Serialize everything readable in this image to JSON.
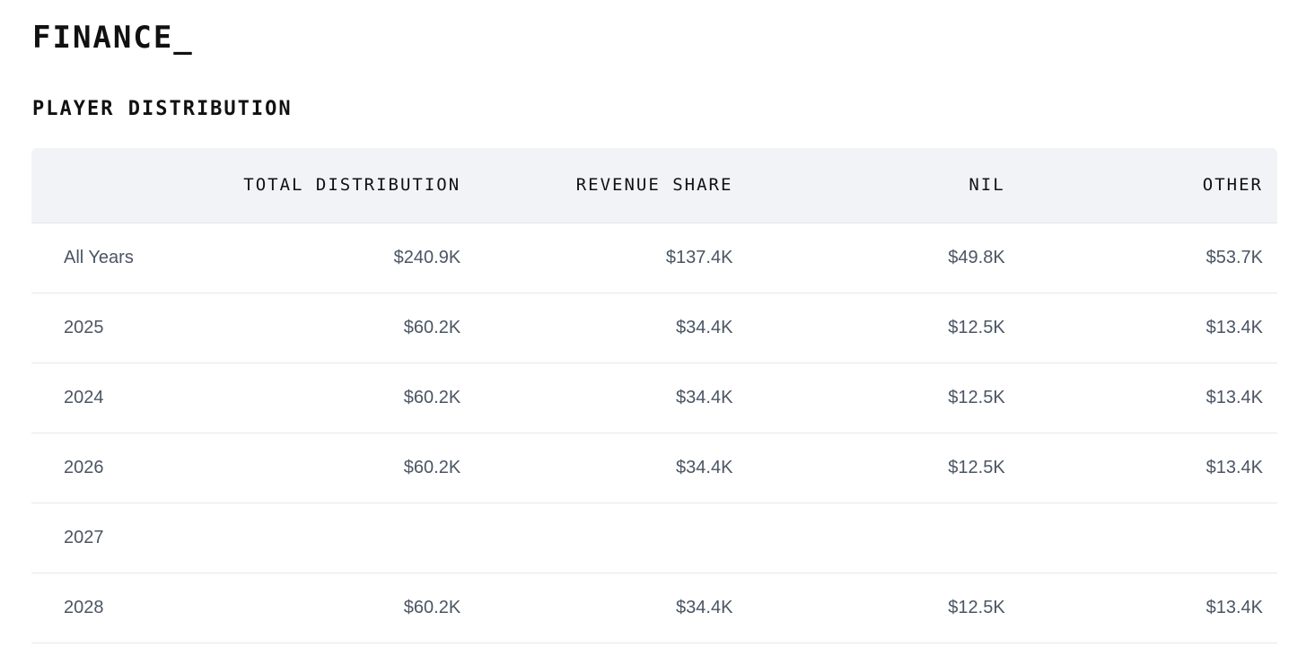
{
  "app": {
    "title": "FINANCE_"
  },
  "section": {
    "title": "PLAYER DISTRIBUTION"
  },
  "table": {
    "headers": [
      "",
      "TOTAL DISTRIBUTION",
      "REVENUE SHARE",
      "NIL",
      "OTHER"
    ],
    "rows": [
      {
        "year": "All Years",
        "total": "$240.9K",
        "revenue_share": "$137.4K",
        "nil": "$49.8K",
        "other": "$53.7K"
      },
      {
        "year": "2025",
        "total": "$60.2K",
        "revenue_share": "$34.4K",
        "nil": "$12.5K",
        "other": "$13.4K"
      },
      {
        "year": "2024",
        "total": "$60.2K",
        "revenue_share": "$34.4K",
        "nil": "$12.5K",
        "other": "$13.4K"
      },
      {
        "year": "2026",
        "total": "$60.2K",
        "revenue_share": "$34.4K",
        "nil": "$12.5K",
        "other": "$13.4K"
      },
      {
        "year": "2027",
        "total": "",
        "revenue_share": "",
        "nil": "",
        "other": ""
      },
      {
        "year": "2028",
        "total": "$60.2K",
        "revenue_share": "$34.4K",
        "nil": "$12.5K",
        "other": "$13.4K"
      }
    ]
  },
  "colors": {
    "header_background": "#f2f3f6",
    "row_divider": "#e5e7eb",
    "cell_text": "#4b5563",
    "heading_text": "#111111"
  }
}
